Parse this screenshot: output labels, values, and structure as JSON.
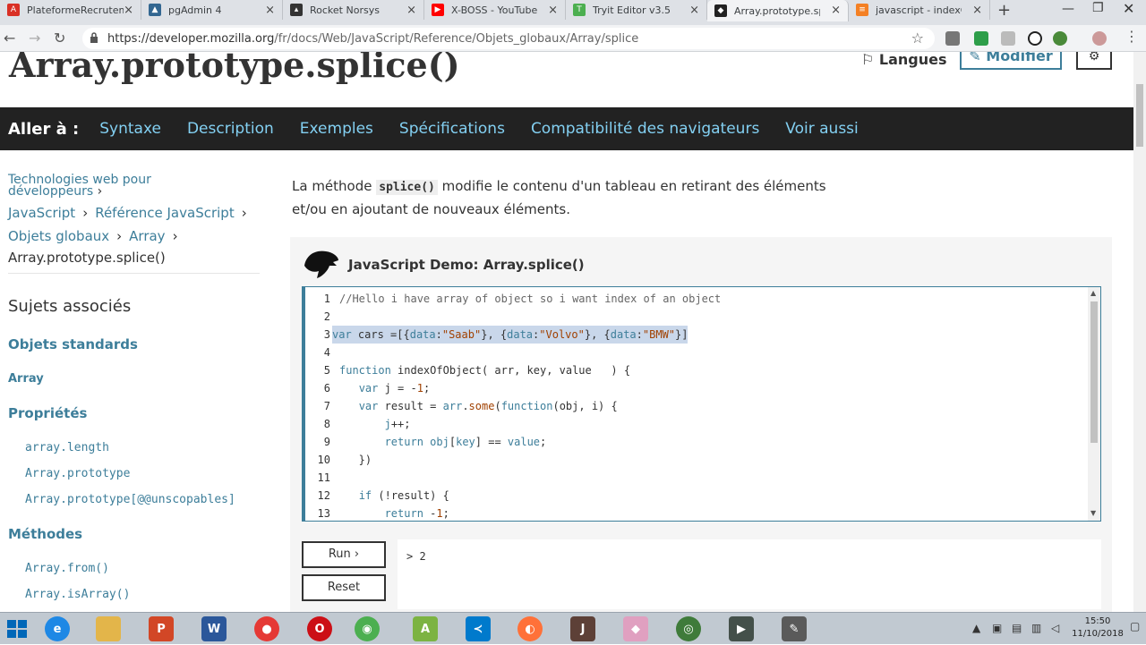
{
  "browser": {
    "tabs": [
      {
        "title": "PlateformeRecruteme",
        "icon": "a-letter-icon",
        "color": "#d93025"
      },
      {
        "title": "pgAdmin 4",
        "icon": "elephant-icon",
        "color": "#336791"
      },
      {
        "title": "Rocket Norsys",
        "icon": "rocket-icon",
        "color": "#333333"
      },
      {
        "title": "X-BOSS - YouTube",
        "icon": "youtube-icon",
        "color": "#ff0000"
      },
      {
        "title": "Tryit Editor v3.5",
        "icon": "tryit-icon",
        "color": "#4caf50"
      },
      {
        "title": "Array.prototype.splice()",
        "icon": "mdn-dino-icon",
        "color": "#222222"
      },
      {
        "title": "javascript - indexOf",
        "icon": "stackoverflow-icon",
        "color": "#f48024"
      }
    ],
    "url_host": "https://developer.mozilla.org",
    "url_path": "/fr/docs/Web/JavaScript/Reference/Objets_globaux/Array/splice"
  },
  "header": {
    "title": "Array.prototype.splice()",
    "langues": "Langues",
    "modifier": "Modifier"
  },
  "jump": {
    "label": "Aller à :",
    "links": [
      "Syntaxe",
      "Description",
      "Exemples",
      "Spécifications",
      "Compatibilité des navigateurs",
      "Voir aussi"
    ]
  },
  "breadcrumb": {
    "line1": "Technologies web pour",
    "line2": "développeurs",
    "javascript": "JavaScript",
    "reference": "Référence JavaScript",
    "objets": "Objets globaux",
    "array": "Array",
    "current": "Array.prototype.splice()"
  },
  "sidebar": {
    "sujets": "Sujets associés",
    "objets_standards": "Objets standards",
    "array": "Array",
    "proprietes": "Propriétés",
    "props": [
      "array.length",
      "Array.prototype",
      "Array.prototype[@@unscopables]"
    ],
    "methodes": "Méthodes",
    "methods": [
      "Array.from()",
      "Array.isArray()"
    ]
  },
  "intro": {
    "before": "La méthode ",
    "code": "splice()",
    "after": " modifie le contenu d'un tableau en retirant des éléments et/ou en ajoutant de nouveaux éléments."
  },
  "demo": {
    "title": "JavaScript Demo: Array.splice()",
    "line_numbers": [
      "1",
      "2",
      "3",
      "4",
      "5",
      "6",
      "7",
      "8",
      "9",
      "10",
      "11",
      "12",
      "13"
    ],
    "run": "Run ›",
    "reset": "Reset",
    "output": "> 2"
  },
  "taskbar": {
    "time": "15:50",
    "date": "11/10/2018"
  }
}
